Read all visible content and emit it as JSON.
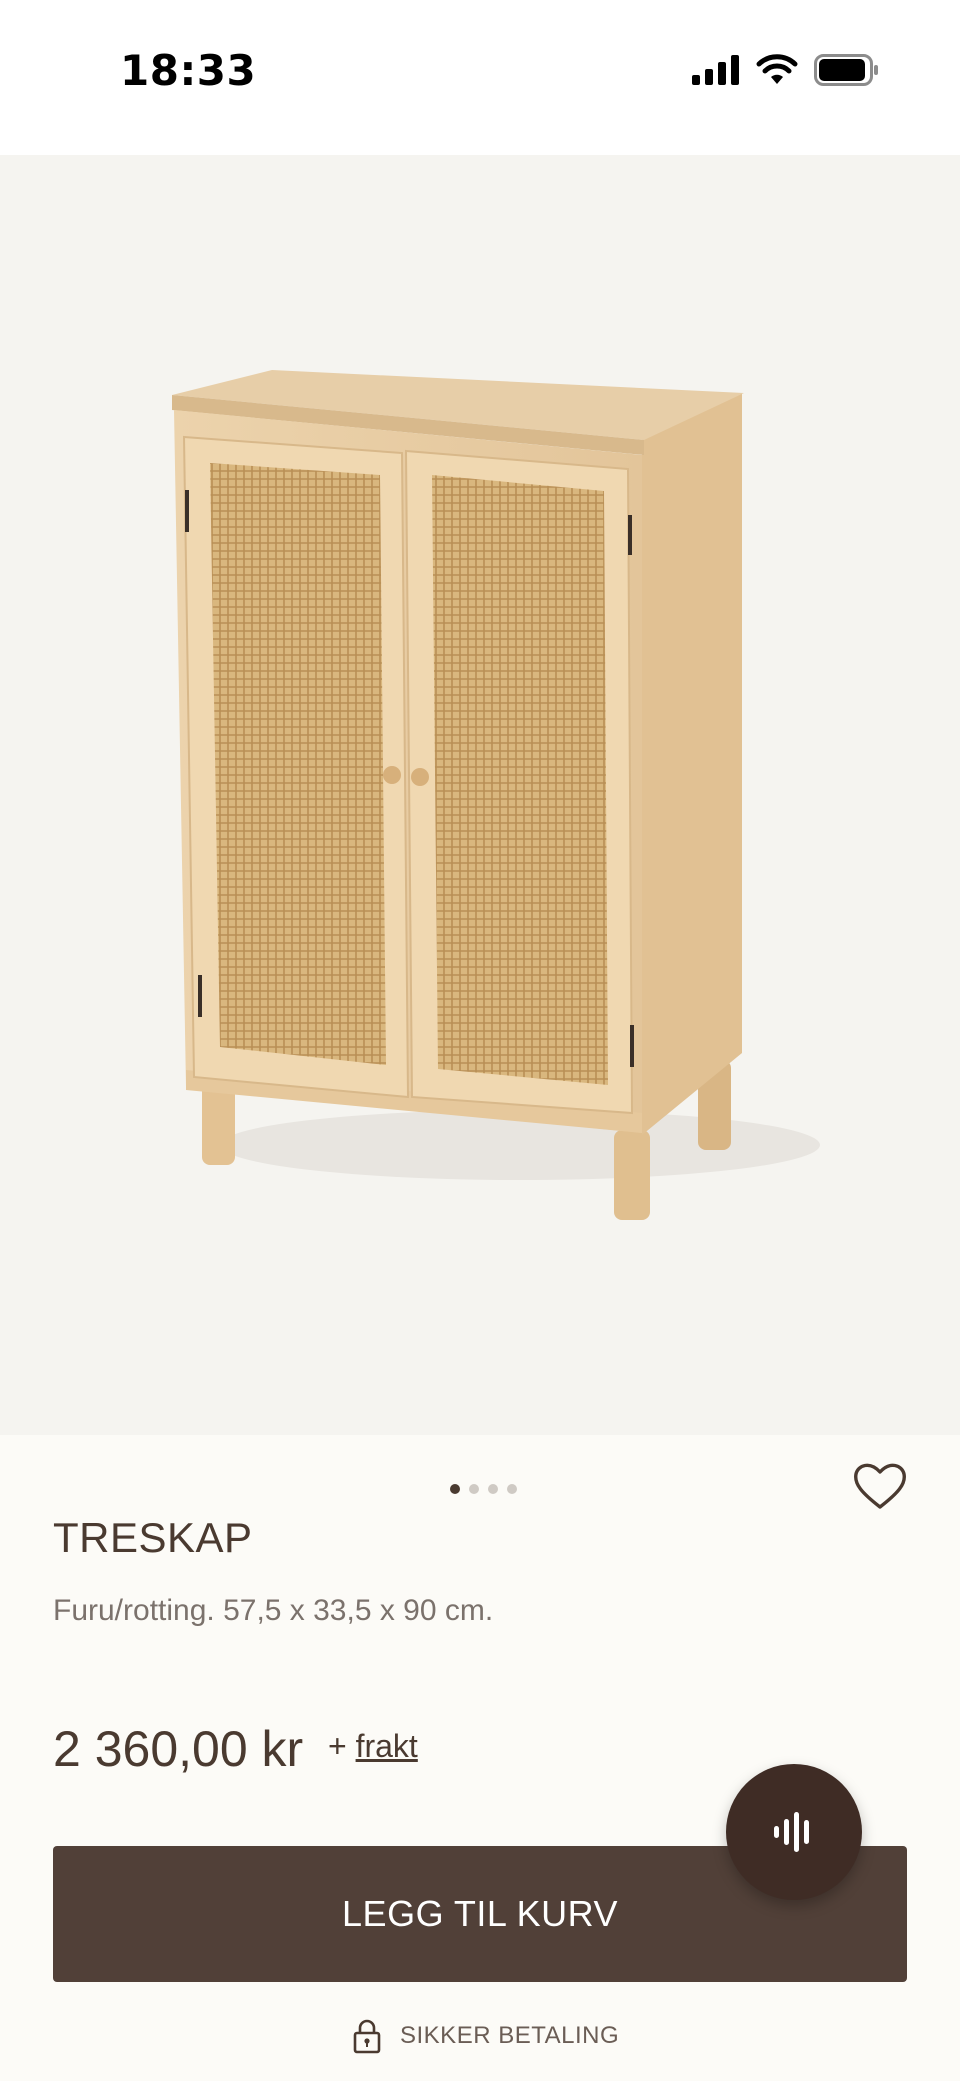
{
  "status_bar": {
    "time": "18:33"
  },
  "gallery": {
    "total_images": 4,
    "active_index": 1
  },
  "product": {
    "title": "TRESKAP",
    "description": "Furu/rotting. 57,5 x 33,5 x 90 cm.",
    "price": "2 360,00 kr",
    "shipping_prefix": "+",
    "shipping_link": "frakt"
  },
  "actions": {
    "add_to_cart_label": "LEGG TIL KURV",
    "secure_payment_label": "SIKKER BETALING"
  },
  "icons": {
    "favorite": "heart-icon",
    "voice": "voice-wave-icon",
    "lock": "lock-icon"
  },
  "colors": {
    "primary_button": "#514038",
    "fab": "#3f2c25",
    "text": "#4a3a30",
    "image_bg": "#f5f4f0"
  }
}
